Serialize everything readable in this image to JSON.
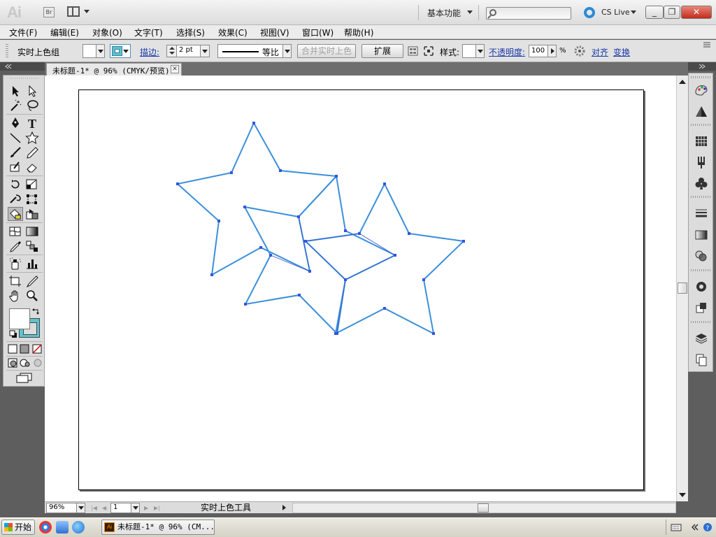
{
  "app": {
    "logo": "Ai",
    "bridge_label": "Br",
    "workspace": "基本功能",
    "cs_live": "CS Live",
    "search_placeholder": ""
  },
  "window_controls": {
    "minimize": "_",
    "restore": "❐",
    "close": "✕"
  },
  "menu": [
    {
      "label": "文件(F)"
    },
    {
      "label": "编辑(E)"
    },
    {
      "label": "对象(O)"
    },
    {
      "label": "文字(T)"
    },
    {
      "label": "选择(S)"
    },
    {
      "label": "效果(C)"
    },
    {
      "label": "视图(V)"
    },
    {
      "label": "窗口(W)"
    },
    {
      "label": "帮助(H)"
    }
  ],
  "control_bar": {
    "object_label": "实时上色组",
    "stroke_label": "描边:",
    "stroke_weight": "2 pt",
    "stroke_profile": "等比",
    "merge_live_paint": "合并实时上色",
    "expand": "扩展",
    "style_label": "样式:",
    "opacity_label": "不透明度:",
    "opacity_value": "100",
    "opacity_unit": "%",
    "align": "对齐",
    "transform": "变换"
  },
  "document": {
    "tab_title": "未标题-1* @ 96% (CMYK/预览)",
    "close": "✕"
  },
  "status_bar": {
    "zoom": "96%",
    "page": "1",
    "current_tool": "实时上色工具"
  },
  "taskbar": {
    "start": "开始",
    "task_title": "未标题-1* @ 96% (CM..."
  },
  "colors": {
    "star_stroke": "#3b8fdb",
    "anchor": "#3355dd",
    "stroke_swatch": "#5bc4cf",
    "accent_link": "#1a3aa8"
  },
  "icons": {
    "tools": [
      "selection-tool-icon",
      "direct-selection-tool-icon",
      "magic-wand-icon",
      "lasso-icon",
      "pen-tool-icon",
      "type-tool-icon",
      "line-segment-icon",
      "star-tool-icon",
      "paintbrush-icon",
      "pencil-icon",
      "blob-brush-icon",
      "eraser-icon",
      "rotate-tool-icon",
      "scale-tool-icon",
      "warp-tool-icon",
      "free-transform-icon",
      "live-paint-bucket-icon",
      "live-paint-selection-icon",
      "mesh-tool-icon",
      "gradient-tool-icon",
      "eyedropper-icon",
      "blend-tool-icon",
      "symbol-sprayer-icon",
      "column-graph-icon",
      "artboard-tool-icon",
      "slice-tool-icon",
      "hand-tool-icon",
      "zoom-tool-icon"
    ]
  }
}
